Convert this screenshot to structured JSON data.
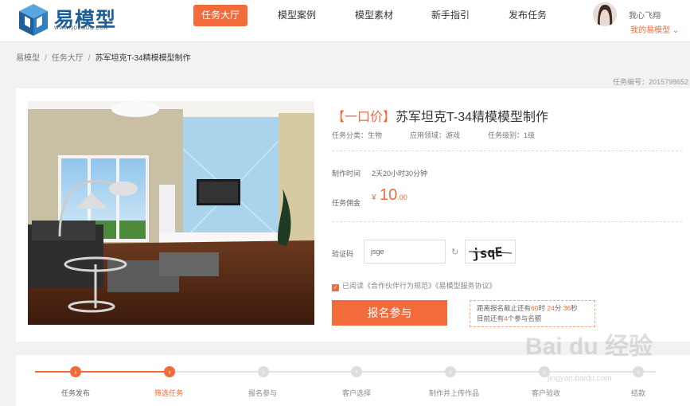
{
  "header": {
    "logo_text": "易模型",
    "logo_sub": "WWW.3DEMOO.COM",
    "nav": [
      {
        "label": "任务大厅",
        "active": true
      },
      {
        "label": "模型案例",
        "active": false
      },
      {
        "label": "模型素材",
        "active": false
      },
      {
        "label": "新手指引",
        "active": false
      },
      {
        "label": "发布任务",
        "active": false
      }
    ],
    "user_name": "我心飞翔",
    "user_menu": "我的易模型"
  },
  "breadcrumb": [
    "易模型",
    "任务大厅",
    "苏军坦克T-34精模模型制作"
  ],
  "task_number": "任务编号：2015798652",
  "task": {
    "tag": "【一口价】",
    "title": "苏军坦克T-34精模模型制作",
    "category": "任务分类：生物",
    "field": "应用领域：游戏",
    "level": "任务级别：1级",
    "time_label": "制作时间",
    "time_value": "2天20小时30分钟",
    "price_label": "任务佣金",
    "price_symbol": "¥",
    "price_int": "10",
    "price_dec": ".00",
    "captcha_label": "验证码",
    "captcha_value": "jsge",
    "captcha_image_text": "jsqE",
    "agree_text": "已阅读《合作伙伴行为规范》《易模型服务协议》",
    "signup_label": "报名参与",
    "deadline_prefix": "距离报名截止还有",
    "deadline_days": "60",
    "deadline_days_unit": "时",
    "deadline_min": "24",
    "deadline_min_unit": "分",
    "deadline_sec": "36",
    "deadline_sec_unit": "秒",
    "slots_prefix": "目前还有",
    "slots": "4",
    "slots_suffix": "个参与名额"
  },
  "steps": [
    {
      "label": "任务发布",
      "done": true
    },
    {
      "label": "筛选任务",
      "done": true
    },
    {
      "label": "报名参与",
      "done": false
    },
    {
      "label": "客户选择",
      "done": false
    },
    {
      "label": "制作并上传作品",
      "done": false
    },
    {
      "label": "客户验收",
      "done": false
    },
    {
      "label": "结款",
      "done": false
    }
  ],
  "watermark": "Bai du 经验",
  "watermark_sub": "jingyan.baidu.com",
  "colors": {
    "accent": "#f26b3a",
    "brand": "#1f5f97",
    "inactive": "#e3e3e3"
  }
}
